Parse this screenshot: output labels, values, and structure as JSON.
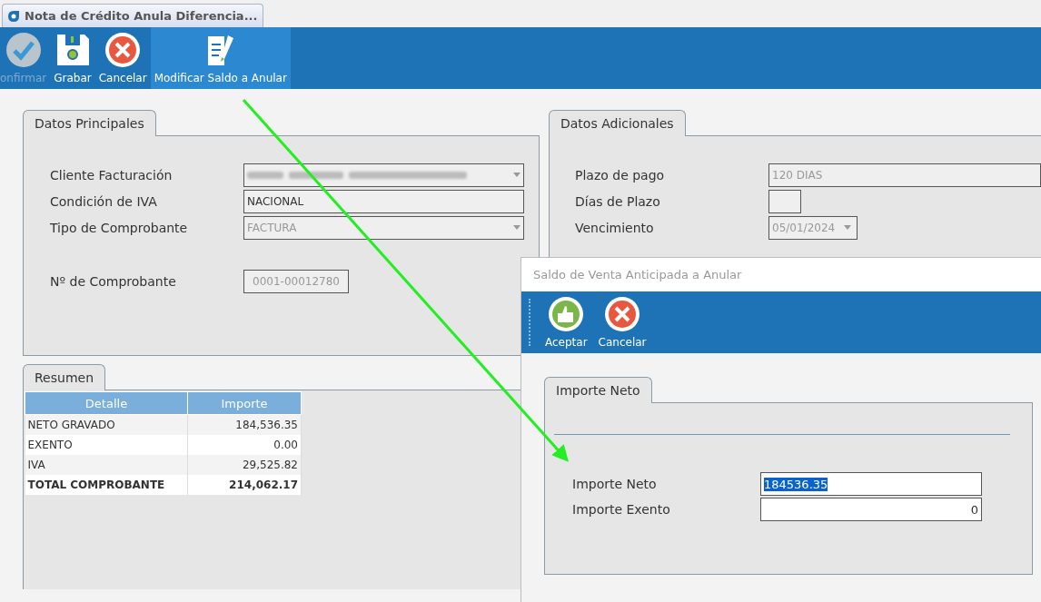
{
  "window": {
    "tab_title": "Nota de Crédito Anula Diferencia..."
  },
  "toolbar": [
    {
      "kind": "confirm",
      "label": "onfirmar",
      "disabled": true,
      "hovered": false
    },
    {
      "kind": "save",
      "label": "Grabar",
      "disabled": false,
      "hovered": false
    },
    {
      "kind": "cancel",
      "label": "Cancelar",
      "disabled": false,
      "hovered": false
    },
    {
      "kind": "edit",
      "label": "Modificar Saldo a Anular",
      "disabled": false,
      "hovered": true
    }
  ],
  "main_panel": {
    "tab": "Datos Principales",
    "fields": [
      {
        "label": "Cliente Facturación",
        "kind": "combo",
        "redacted": true,
        "disabled": true
      },
      {
        "label": "Condición de IVA",
        "kind": "text",
        "value": "NACIONAL",
        "disabled": false
      },
      {
        "label": "Tipo de Comprobante",
        "kind": "combo",
        "value": "FACTURA",
        "disabled": true
      },
      {
        "label": "Nº de Comprobante",
        "kind": "short",
        "value": "0001-00012780",
        "disabled": true
      }
    ]
  },
  "extra_panel": {
    "tab": "Datos Adicionales",
    "fields": [
      {
        "label": "Plazo de pago",
        "kind": "text",
        "value": "120 DIAS",
        "disabled": true
      },
      {
        "label": "Días de Plazo",
        "kind": "tiny"
      },
      {
        "label": "Vencimiento",
        "kind": "date",
        "value": "05/01/2024",
        "disabled": true
      }
    ]
  },
  "summary": {
    "tab": "Resumen",
    "columns": [
      "Detalle",
      "Importe"
    ],
    "rows": [
      {
        "kind": "normal",
        "cells": [
          "NETO GRAVADO",
          "184,536.35"
        ]
      },
      {
        "kind": "normal",
        "cells": [
          "EXENTO",
          "0.00"
        ]
      },
      {
        "kind": "normal",
        "cells": [
          "IVA",
          "29,525.82"
        ]
      },
      {
        "kind": "total",
        "cells": [
          "TOTAL COMPROBANTE",
          "214,062.17"
        ]
      }
    ]
  },
  "dialog": {
    "title": "Saldo de Venta Anticipada a Anular",
    "toolbar": [
      {
        "kind": "accept",
        "label": "Aceptar"
      },
      {
        "kind": "cancel",
        "label": "Cancelar"
      }
    ],
    "tab": "Importe Neto",
    "fields": [
      {
        "label": "Importe Neto",
        "value": "184536.35",
        "selected": true
      },
      {
        "label": "Importe Exento",
        "value": "0",
        "selected": false
      }
    ]
  }
}
